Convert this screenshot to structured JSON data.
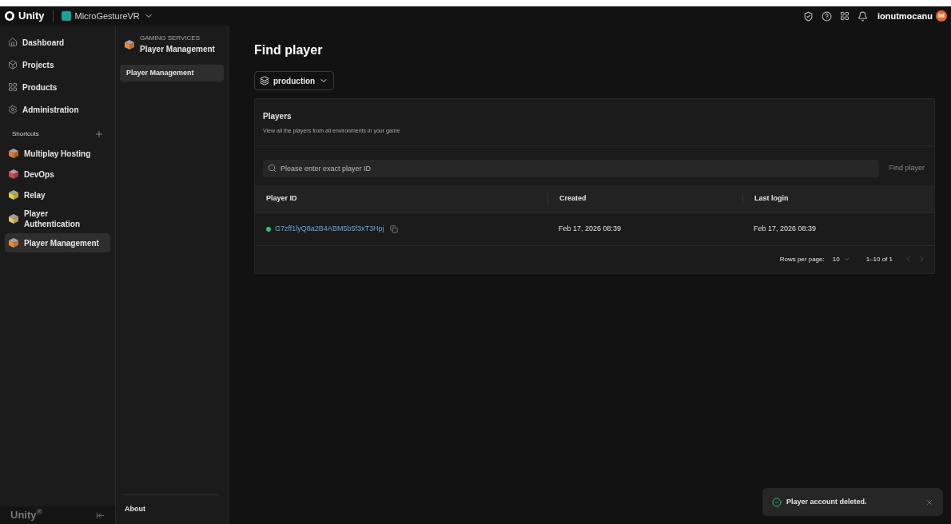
{
  "topbar": {
    "brand": "Unity",
    "project": "MicroGestureVR",
    "user": "ionutmocanu",
    "avatar": "IM"
  },
  "sidebar": {
    "items": [
      {
        "label": "Dashboard",
        "selected": false
      },
      {
        "label": "Projects",
        "selected": false
      },
      {
        "label": "Products",
        "selected": false
      },
      {
        "label": "Administration",
        "selected": false
      }
    ],
    "shortcuts_title": "Shortcuts",
    "shortcuts": [
      {
        "label": "Multiplay Hosting",
        "color": "#e8782a",
        "selected": false
      },
      {
        "label": "DevOps",
        "color": "#d9434f",
        "selected": false
      },
      {
        "label": "Relay",
        "color": "#e6d23a",
        "selected": false
      },
      {
        "label": "Player Authentication",
        "color": "#e8c86a",
        "selected": false
      },
      {
        "label": "Player Management",
        "color": "#ee8a3c",
        "selected": true
      }
    ],
    "footer": "Unity$^{®}$"
  },
  "subnav": {
    "category": "GAMING SERVICES",
    "title": "Player Management",
    "items": [
      {
        "label": "Player Management",
        "selected": true
      }
    ],
    "about": "About"
  },
  "main": {
    "title": "Find player",
    "environment": "production",
    "card": {
      "title": "Players",
      "subtitle": "View all the players from all environments in your game",
      "search": {
        "placeholder": "Please enter exact player ID",
        "button": "Find player"
      },
      "columns": [
        "Player ID",
        "Created",
        "Last login"
      ],
      "rows": [
        {
          "player_id": "G7zff1lyQ8a2B4ABM5b5f3xT3Hpj",
          "online": true,
          "created": "Feb 17, 2026 08:39",
          "last_login": "Feb 17, 2026 08:39"
        }
      ],
      "pagination": {
        "rows_label": "Rows per page:",
        "rows_value": "10",
        "range": "1–10 of 1"
      }
    }
  },
  "toast": {
    "message": "Player account deleted."
  }
}
